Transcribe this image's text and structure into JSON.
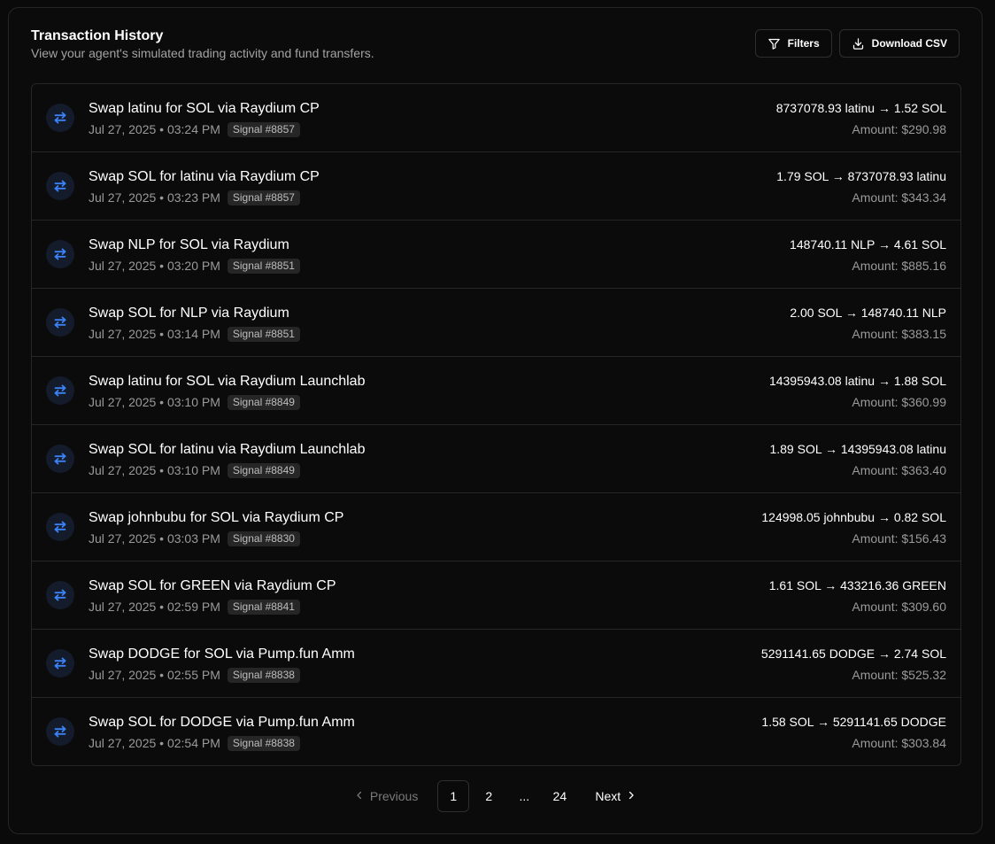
{
  "header": {
    "title": "Transaction History",
    "subtitle": "View your agent's simulated trading activity and fund transfers.",
    "filters_label": "Filters",
    "download_label": "Download CSV"
  },
  "colors": {
    "accent": "#3b82f6",
    "icon_bg": "#141b2b",
    "badge_bg": "#262626",
    "border": "#262626"
  },
  "transactions": [
    {
      "title": "Swap latinu for SOL via Raydium CP",
      "date": "Jul 27, 2025 • 03:24 PM",
      "signal": "Signal #8857",
      "swap": "8737078.93 latinu → 1.52 SOL",
      "amount": "Amount: $290.98",
      "icon": "swap-arrows-icon"
    },
    {
      "title": "Swap SOL for latinu via Raydium CP",
      "date": "Jul 27, 2025 • 03:23 PM",
      "signal": "Signal #8857",
      "swap": "1.79 SOL → 8737078.93 latinu",
      "amount": "Amount: $343.34",
      "icon": "swap-arrows-icon"
    },
    {
      "title": "Swap NLP for SOL via Raydium",
      "date": "Jul 27, 2025 • 03:20 PM",
      "signal": "Signal #8851",
      "swap": "148740.11 NLP → 4.61 SOL",
      "amount": "Amount: $885.16",
      "icon": "swap-arrows-icon"
    },
    {
      "title": "Swap SOL for NLP via Raydium",
      "date": "Jul 27, 2025 • 03:14 PM",
      "signal": "Signal #8851",
      "swap": "2.00 SOL → 148740.11 NLP",
      "amount": "Amount: $383.15",
      "icon": "swap-arrows-icon"
    },
    {
      "title": "Swap latinu for SOL via Raydium Launchlab",
      "date": "Jul 27, 2025 • 03:10 PM",
      "signal": "Signal #8849",
      "swap": "14395943.08 latinu → 1.88 SOL",
      "amount": "Amount: $360.99",
      "icon": "swap-arrows-icon"
    },
    {
      "title": "Swap SOL for latinu via Raydium Launchlab",
      "date": "Jul 27, 2025 • 03:10 PM",
      "signal": "Signal #8849",
      "swap": "1.89 SOL → 14395943.08 latinu",
      "amount": "Amount: $363.40",
      "icon": "swap-arrows-icon"
    },
    {
      "title": "Swap johnbubu for SOL via Raydium CP",
      "date": "Jul 27, 2025 • 03:03 PM",
      "signal": "Signal #8830",
      "swap": "124998.05 johnbubu → 0.82 SOL",
      "amount": "Amount: $156.43",
      "icon": "swap-arrows-icon"
    },
    {
      "title": "Swap SOL for GREEN via Raydium CP",
      "date": "Jul 27, 2025 • 02:59 PM",
      "signal": "Signal #8841",
      "swap": "1.61 SOL → 433216.36 GREEN",
      "amount": "Amount: $309.60",
      "icon": "swap-arrows-icon"
    },
    {
      "title": "Swap DODGE for SOL via Pump.fun Amm",
      "date": "Jul 27, 2025 • 02:55 PM",
      "signal": "Signal #8838",
      "swap": "5291141.65 DODGE → 2.74 SOL",
      "amount": "Amount: $525.32",
      "icon": "swap-arrows-icon"
    },
    {
      "title": "Swap SOL for DODGE via Pump.fun Amm",
      "date": "Jul 27, 2025 • 02:54 PM",
      "signal": "Signal #8838",
      "swap": "1.58 SOL → 5291141.65 DODGE",
      "amount": "Amount: $303.84",
      "icon": "swap-arrows-icon"
    }
  ],
  "pagination": {
    "previous_label": "Previous",
    "next_label": "Next",
    "pages": [
      "1",
      "2"
    ],
    "ellipsis": "...",
    "last_page": "24",
    "current_page": "1"
  }
}
